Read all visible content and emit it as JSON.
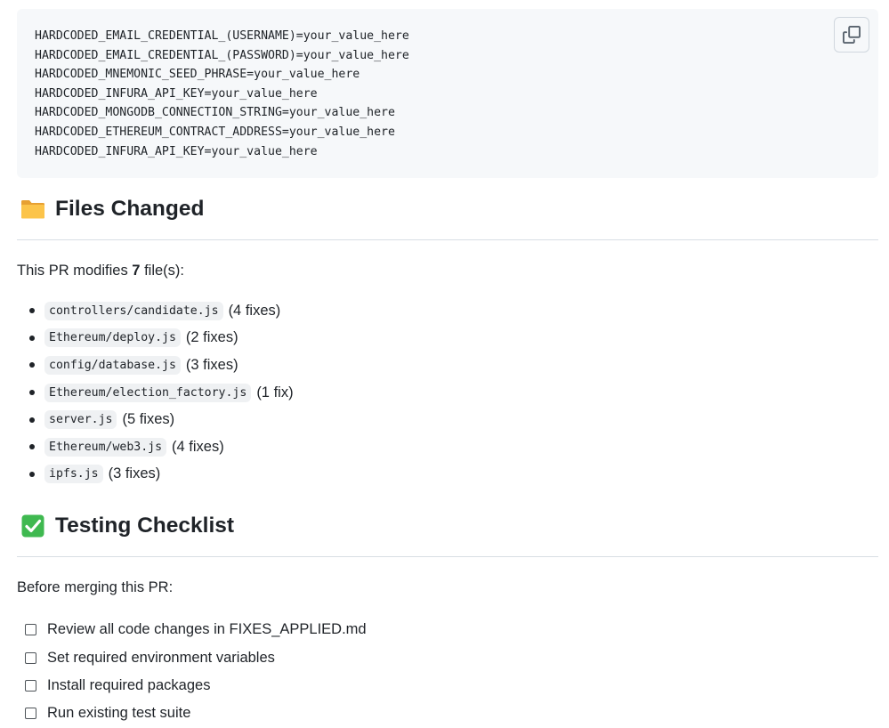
{
  "code_block": {
    "lines": [
      "HARDCODED_EMAIL_CREDENTIAL_(USERNAME)=your_value_here",
      "HARDCODED_EMAIL_CREDENTIAL_(PASSWORD)=your_value_here",
      "HARDCODED_MNEMONIC_SEED_PHRASE=your_value_here",
      "HARDCODED_INFURA_API_KEY=your_value_here",
      "HARDCODED_MONGODB_CONNECTION_STRING=your_value_here",
      "HARDCODED_ETHEREUM_CONTRACT_ADDRESS=your_value_here",
      "HARDCODED_INFURA_API_KEY=your_value_here"
    ],
    "copy_icon": "copy-icon"
  },
  "files_section": {
    "emoji": "folder-icon",
    "title": "Files Changed",
    "intro_prefix": "This PR modifies ",
    "intro_count": "7",
    "intro_suffix": " file(s):",
    "files": [
      {
        "path": "controllers/candidate.js",
        "fixes": "(4 fixes)"
      },
      {
        "path": "Ethereum/deploy.js",
        "fixes": "(2 fixes)"
      },
      {
        "path": "config/database.js",
        "fixes": "(3 fixes)"
      },
      {
        "path": "Ethereum/election_factory.js",
        "fixes": "(1 fix)"
      },
      {
        "path": "server.js",
        "fixes": "(5 fixes)"
      },
      {
        "path": "Ethereum/web3.js",
        "fixes": "(4 fixes)"
      },
      {
        "path": "ipfs.js",
        "fixes": "(3 fixes)"
      }
    ]
  },
  "testing_section": {
    "emoji": "check-mark-button-icon",
    "title": "Testing Checklist",
    "intro": "Before merging this PR:",
    "items": [
      {
        "label": "Review all code changes in FIXES_APPLIED.md",
        "checked": false
      },
      {
        "label": "Set required environment variables",
        "checked": false
      },
      {
        "label": "Install required packages",
        "checked": false
      },
      {
        "label": "Run existing test suite",
        "checked": false
      }
    ]
  },
  "colors": {
    "text": "#1f2328",
    "code_bg": "#f6f8fa",
    "inline_code_bg": "#eff1f3",
    "border": "#d8dee4",
    "check_green": "#3fb950"
  }
}
